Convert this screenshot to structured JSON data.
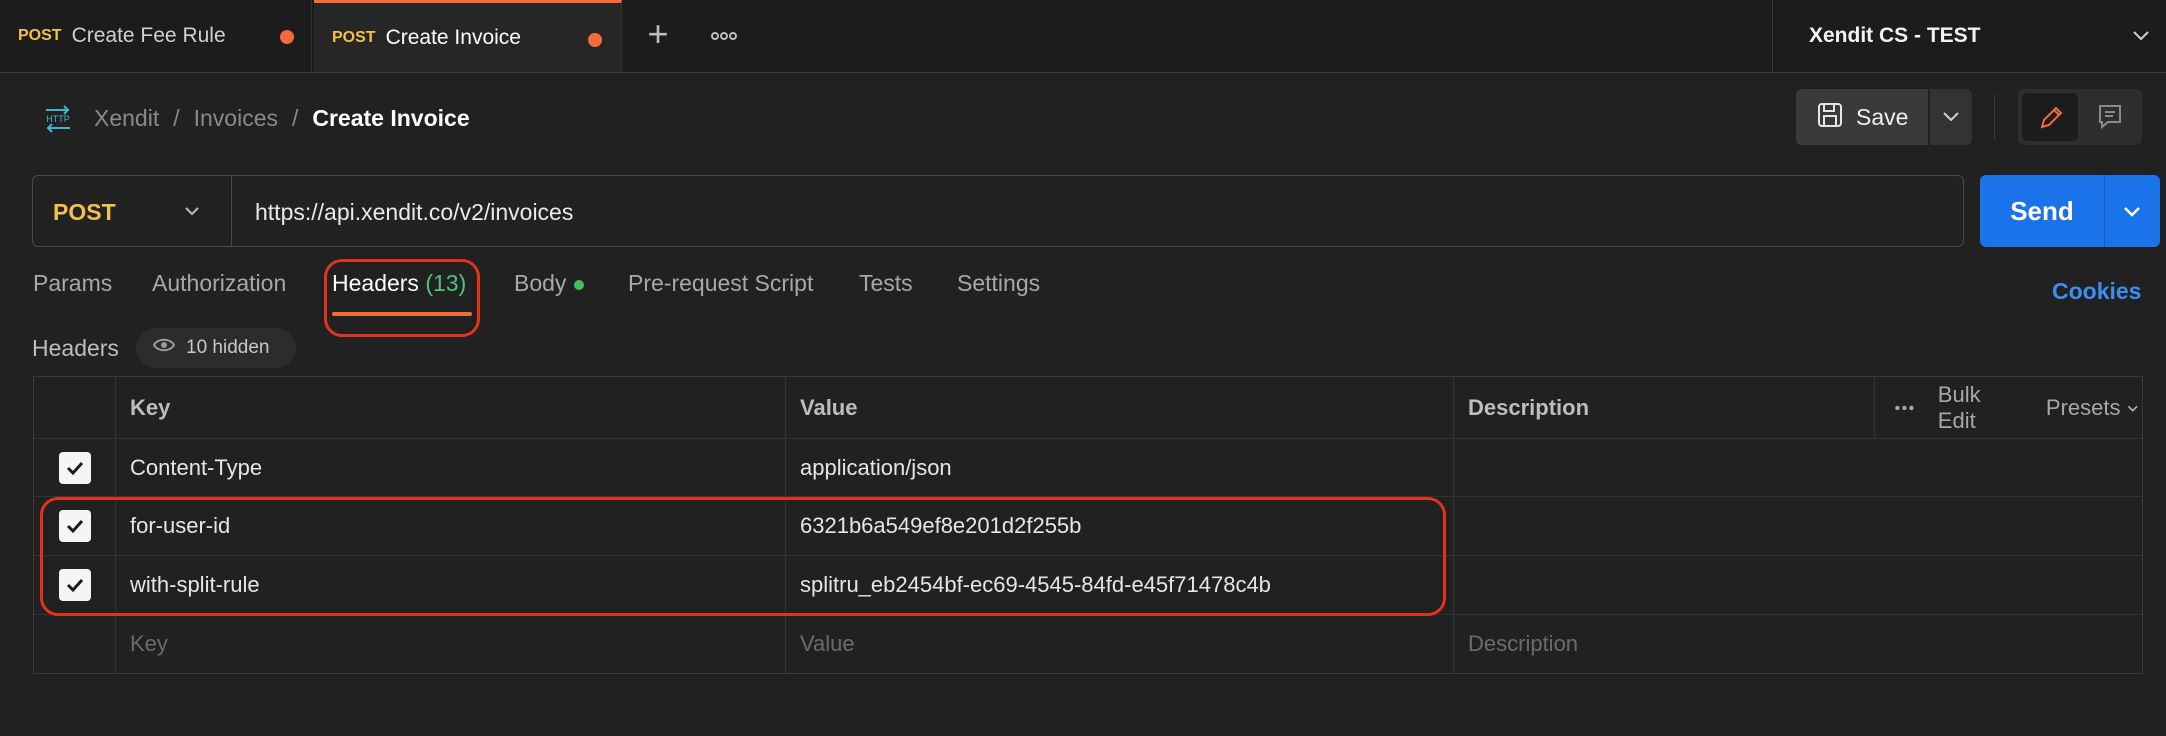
{
  "tabs": [
    {
      "method": "POST",
      "label": "Create Fee Rule",
      "active": false
    },
    {
      "method": "POST",
      "label": "Create Invoice",
      "active": true
    }
  ],
  "environment": "Xendit CS - TEST",
  "breadcrumb": {
    "icon": "HTTP",
    "parts": [
      "Xendit",
      "Invoices"
    ],
    "current": "Create Invoice",
    "sep": "/"
  },
  "save_label": "Save",
  "request": {
    "method": "POST",
    "url": "https://api.xendit.co/v2/invoices",
    "send_label": "Send"
  },
  "request_tabs": {
    "params": "Params",
    "authorization": "Authorization",
    "headers": "Headers",
    "headers_count": "(13)",
    "body": "Body",
    "prerequest": "Pre-request Script",
    "tests": "Tests",
    "settings": "Settings"
  },
  "cookies_label": "Cookies",
  "headers_section": {
    "title": "Headers",
    "hidden_label": "10 hidden"
  },
  "table": {
    "columns": {
      "key": "Key",
      "value": "Value",
      "description": "Description"
    },
    "tools": {
      "bulk_edit": "Bulk Edit",
      "presets": "Presets"
    },
    "rows": [
      {
        "key": "Content-Type",
        "value": "application/json",
        "checked": true
      },
      {
        "key": "for-user-id",
        "value": "6321b6a549ef8e201d2f255b",
        "checked": true
      },
      {
        "key": "with-split-rule",
        "value": "splitru_eb2454bf-ec69-4545-84fd-e45f71478c4b",
        "checked": true
      }
    ],
    "placeholder": {
      "key": "Key",
      "value": "Value",
      "description": "Description"
    }
  },
  "colors": {
    "accent": "#f26b3a",
    "send": "#1a73e8",
    "method": "#f2c14e",
    "highlight": "#e0341c"
  }
}
